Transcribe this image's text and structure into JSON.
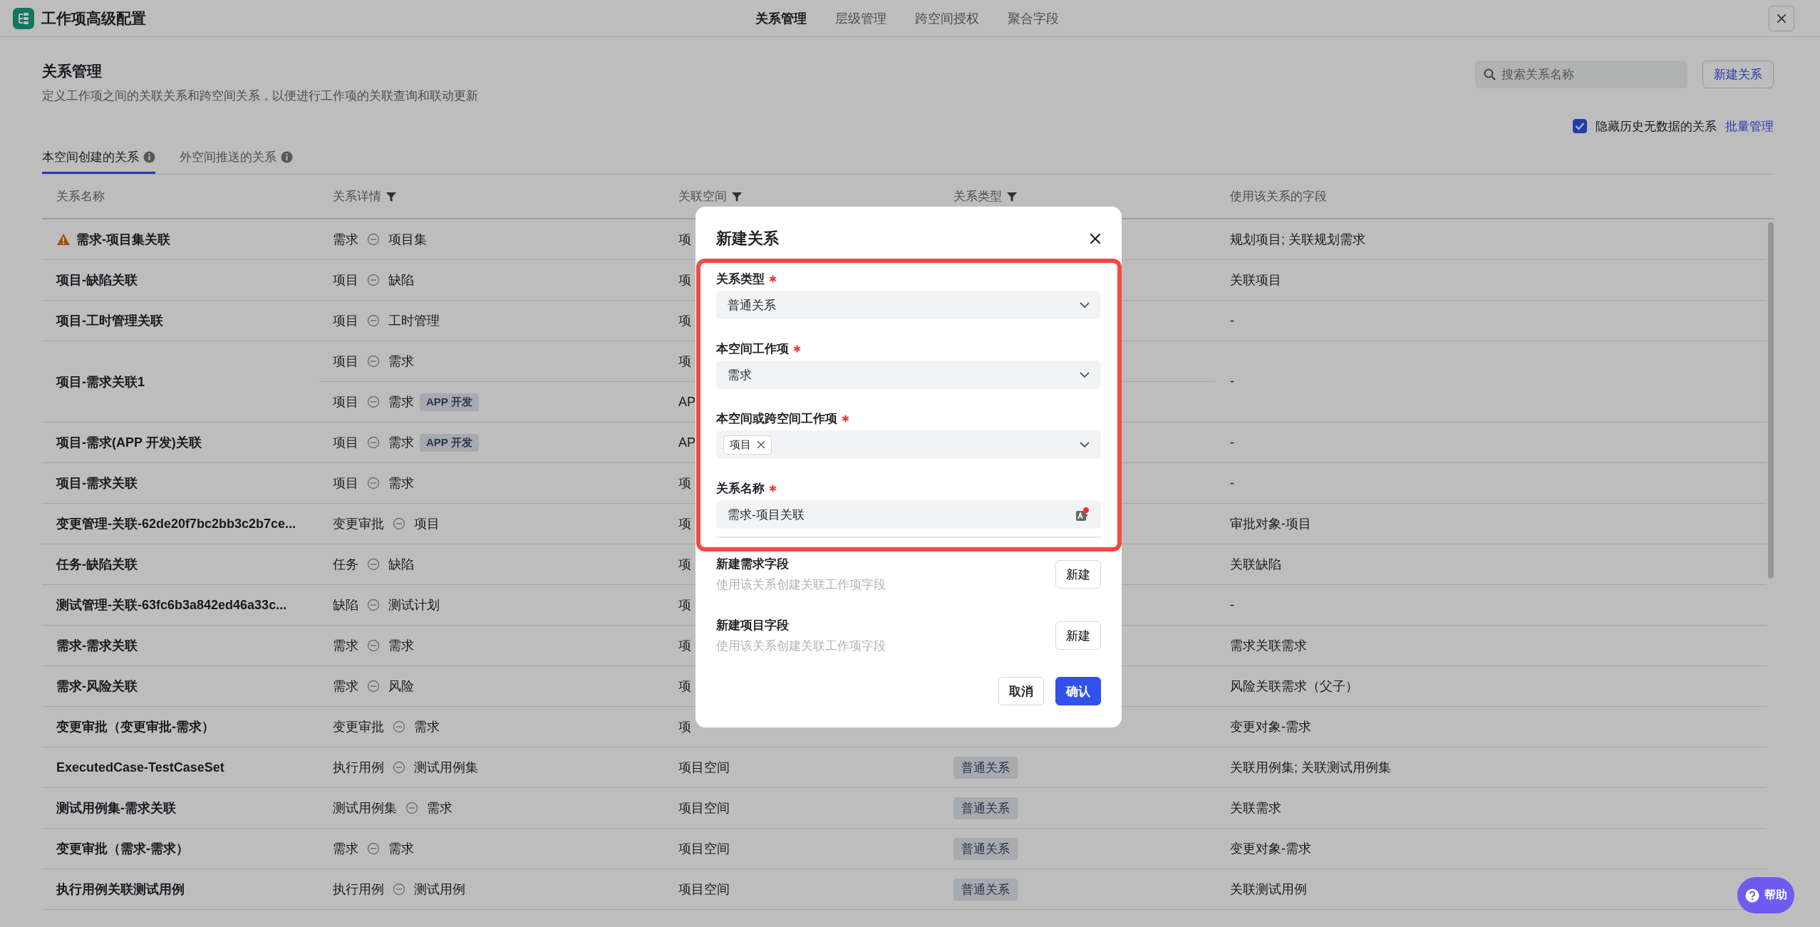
{
  "app": {
    "title": "工作项高级配置"
  },
  "nav_tabs": [
    {
      "label": "关系管理",
      "selected": true
    },
    {
      "label": "层级管理",
      "selected": false
    },
    {
      "label": "跨空间授权",
      "selected": false
    },
    {
      "label": "聚合字段",
      "selected": false
    }
  ],
  "page": {
    "title": "关系管理",
    "description": "定义工作项之间的关联关系和跨空间关系，以便进行工作项的关联查询和联动更新",
    "search": {
      "placeholder": "搜索关系名称"
    },
    "new_button": "新建关系",
    "hide_empty": {
      "label": "隐藏历史无数据的关系",
      "checked": true
    },
    "batch_link": "批量管理"
  },
  "sub_tabs": [
    {
      "label": "本空间创建的关系",
      "selected": true
    },
    {
      "label": "外空间推送的关系",
      "selected": false
    }
  ],
  "table": {
    "columns": [
      {
        "label": "关系名称",
        "filter": false
      },
      {
        "label": "关系详情",
        "filter": true
      },
      {
        "label": "关联空间",
        "filter": true
      },
      {
        "label": "关系类型",
        "filter": true
      },
      {
        "label": "使用该关系的字段",
        "filter": false
      }
    ],
    "rows": [
      {
        "name": "需求-项目集关联",
        "warning": true,
        "details": [
          {
            "from": "需求",
            "to": "项目集",
            "space": "项"
          }
        ],
        "fields": "规划项目; 关联规划需求"
      },
      {
        "name": "项目-缺陷关联",
        "warning": false,
        "details": [
          {
            "from": "项目",
            "to": "缺陷",
            "space": "项"
          }
        ],
        "fields": "关联项目"
      },
      {
        "name": "项目-工时管理关联",
        "warning": false,
        "details": [
          {
            "from": "项目",
            "to": "工时管理",
            "space": "项"
          }
        ],
        "fields": "-"
      },
      {
        "name": "项目-需求关联1",
        "warning": false,
        "details": [
          {
            "from": "项目",
            "to": "需求",
            "space": "项"
          },
          {
            "from": "项目",
            "to": "需求",
            "tag": "APP 开发",
            "space": "AP"
          }
        ],
        "fields": "-"
      },
      {
        "name": "项目-需求(APP 开发)关联",
        "warning": false,
        "details": [
          {
            "from": "项目",
            "to": "需求",
            "tag": "APP 开发",
            "space": "AP"
          }
        ],
        "fields": "-"
      },
      {
        "name": "项目-需求关联",
        "warning": false,
        "details": [
          {
            "from": "项目",
            "to": "需求",
            "space": "项"
          }
        ],
        "fields": "-"
      },
      {
        "name": "变更管理-关联-62de20f7bc2bb3c2b7ce...",
        "warning": false,
        "details": [
          {
            "from": "变更审批",
            "to": "项目",
            "space": "项"
          }
        ],
        "fields": "审批对象-项目"
      },
      {
        "name": "任务-缺陷关联",
        "warning": false,
        "details": [
          {
            "from": "任务",
            "to": "缺陷",
            "space": "项"
          }
        ],
        "fields": "关联缺陷"
      },
      {
        "name": "测试管理-关联-63fc6b3a842ed46a33c...",
        "warning": false,
        "details": [
          {
            "from": "缺陷",
            "to": "测试计划",
            "space": "项"
          }
        ],
        "fields": "-"
      },
      {
        "name": "需求-需求关联",
        "warning": false,
        "details": [
          {
            "from": "需求",
            "to": "需求",
            "space": "项"
          }
        ],
        "fields": "需求关联需求"
      },
      {
        "name": "需求-风险关联",
        "warning": false,
        "details": [
          {
            "from": "需求",
            "to": "风险",
            "space": "项"
          }
        ],
        "fields": "风险关联需求（父子）"
      },
      {
        "name": "变更审批（变更审批-需求）",
        "warning": false,
        "details": [
          {
            "from": "变更审批",
            "to": "需求",
            "space": "项"
          }
        ],
        "fields": "变更对象-需求"
      },
      {
        "name": "ExecutedCase-TestCaseSet",
        "warning": false,
        "details": [
          {
            "from": "执行用例",
            "to": "测试用例集",
            "space": "项目空间",
            "type": "普通关系"
          }
        ],
        "fields": "关联用例集; 关联测试用例集"
      },
      {
        "name": "测试用例集-需求关联",
        "warning": false,
        "details": [
          {
            "from": "测试用例集",
            "to": "需求",
            "space": "项目空间",
            "type": "普通关系"
          }
        ],
        "fields": "关联需求"
      },
      {
        "name": "变更审批（需求-需求）",
        "warning": false,
        "details": [
          {
            "from": "需求",
            "to": "需求",
            "space": "项目空间",
            "type": "普通关系"
          }
        ],
        "fields": "变更对象-需求"
      },
      {
        "name": "执行用例关联测试用例",
        "warning": false,
        "details": [
          {
            "from": "执行用例",
            "to": "测试用例",
            "space": "项目空间",
            "type": "普通关系"
          }
        ],
        "fields": "关联测试用例"
      }
    ]
  },
  "dialog": {
    "title": "新建关系",
    "fields": [
      {
        "label": "关系类型",
        "required": true,
        "kind": "select",
        "value": "普通关系"
      },
      {
        "label": "本空间工作项",
        "required": true,
        "kind": "select",
        "value": "需求"
      },
      {
        "label": "本空间或跨空间工作项",
        "required": true,
        "kind": "multiselect",
        "chips": [
          "项目"
        ]
      },
      {
        "label": "关系名称",
        "required": true,
        "kind": "text",
        "value": "需求-项目关联"
      }
    ],
    "extra_fields": [
      {
        "title": "新建需求字段",
        "hint": "使用该关系创建关联工作项字段",
        "button": "新建"
      },
      {
        "title": "新建项目字段",
        "hint": "使用该关系创建关联工作项字段",
        "button": "新建"
      }
    ],
    "buttons": [
      {
        "label": "取消",
        "kind": "secondary"
      },
      {
        "label": "确认",
        "kind": "primary"
      }
    ]
  },
  "help": {
    "label": "帮助"
  }
}
